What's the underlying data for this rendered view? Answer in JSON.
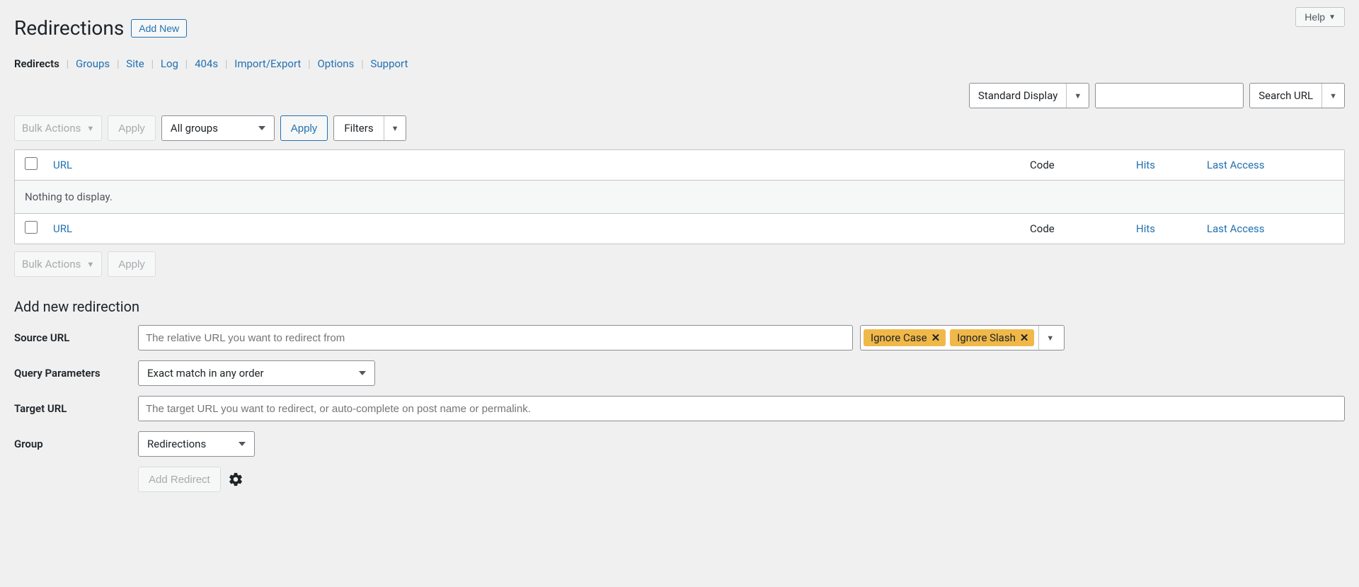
{
  "help_label": "Help",
  "page_title": "Redirections",
  "add_new_label": "Add New",
  "subnav": [
    "Redirects",
    "Groups",
    "Site",
    "Log",
    "404s",
    "Import/Export",
    "Options",
    "Support"
  ],
  "subnav_active": "Redirects",
  "display_mode": "Standard Display",
  "search_label": "Search URL",
  "bulk_actions_label": "Bulk Actions",
  "apply_label": "Apply",
  "groups_select": "All groups",
  "filters_label": "Filters",
  "columns": {
    "url": "URL",
    "code": "Code",
    "hits": "Hits",
    "last": "Last Access"
  },
  "empty_message": "Nothing to display.",
  "form_title": "Add new redirection",
  "source_label": "Source URL",
  "source_placeholder": "The relative URL you want to redirect from",
  "tags": [
    "Ignore Case",
    "Ignore Slash"
  ],
  "query_label": "Query Parameters",
  "query_select": "Exact match in any order",
  "target_label": "Target URL",
  "target_placeholder": "The target URL you want to redirect, or auto-complete on post name or permalink.",
  "group_label": "Group",
  "group_select": "Redirections",
  "add_redirect_label": "Add Redirect"
}
